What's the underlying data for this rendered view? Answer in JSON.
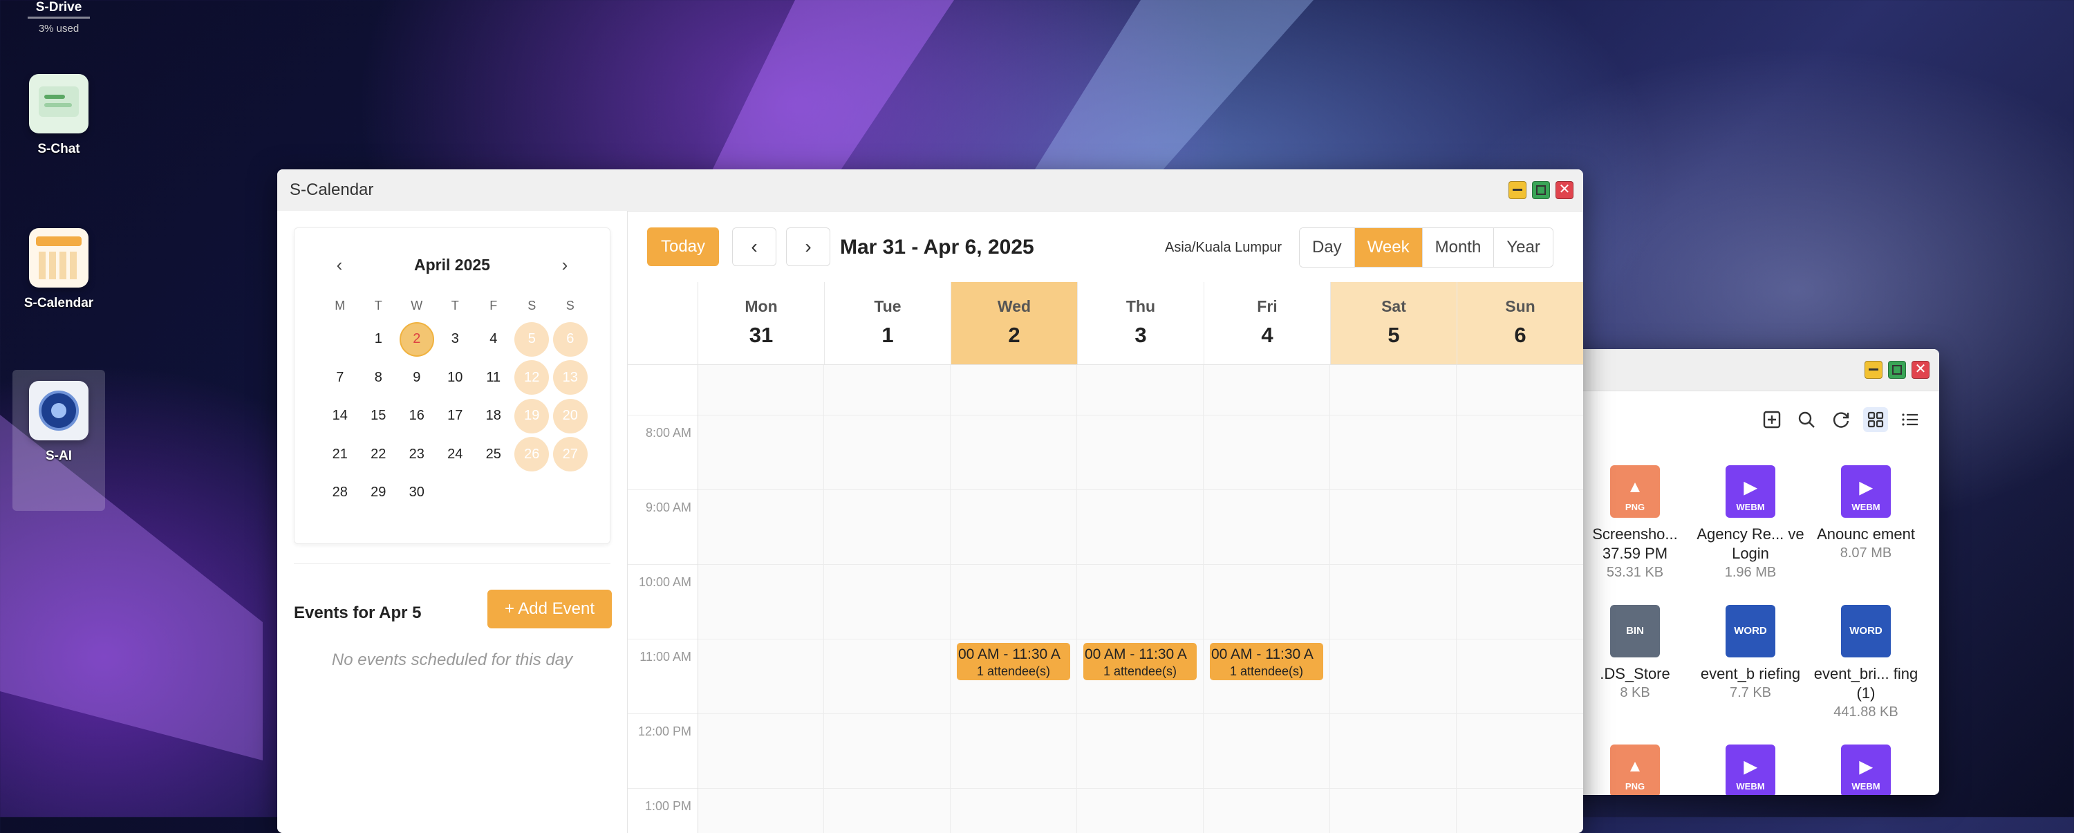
{
  "desktop": {
    "drive_label": "S-Drive",
    "drive_usage": "3% used",
    "icons": [
      {
        "label": "S-Chat",
        "icon": "chat-app-icon"
      },
      {
        "label": "S-Calendar",
        "icon": "calendar-app-icon"
      },
      {
        "label": "S-AI",
        "icon": "ai-app-icon"
      }
    ]
  },
  "calendar_window": {
    "title": "S-Calendar",
    "mini_calendar": {
      "month_label": "April 2025",
      "weekdays": [
        "M",
        "T",
        "W",
        "T",
        "F",
        "S",
        "S"
      ],
      "weeks": [
        [
          "",
          "1",
          "2",
          "3",
          "4",
          "5",
          "6"
        ],
        [
          "7",
          "8",
          "9",
          "10",
          "11",
          "12",
          "13"
        ],
        [
          "14",
          "15",
          "16",
          "17",
          "18",
          "19",
          "20"
        ],
        [
          "21",
          "22",
          "23",
          "24",
          "25",
          "26",
          "27"
        ],
        [
          "28",
          "29",
          "30",
          "",
          "",
          "",
          ""
        ]
      ],
      "today": "2"
    },
    "events_title": "Events for Apr 5",
    "add_event_label": "+ Add Event",
    "no_events_text": "No events scheduled for this day",
    "toolbar": {
      "today_label": "Today",
      "prev_icon": "chevron-left-icon",
      "next_icon": "chevron-right-icon",
      "range_label": "Mar 31 - Apr 6, 2025",
      "timezone": "Asia/Kuala Lumpur",
      "views": [
        "Day",
        "Week",
        "Month",
        "Year"
      ],
      "active_view": "Week"
    },
    "week_days": [
      {
        "name": "Mon",
        "date": "31"
      },
      {
        "name": "Tue",
        "date": "1"
      },
      {
        "name": "Wed",
        "date": "2"
      },
      {
        "name": "Thu",
        "date": "3"
      },
      {
        "name": "Fri",
        "date": "4"
      },
      {
        "name": "Sat",
        "date": "5"
      },
      {
        "name": "Sun",
        "date": "6"
      }
    ],
    "hour_labels": [
      "8:00 AM",
      "9:00 AM",
      "10:00 AM",
      "11:00 AM",
      "12:00 PM",
      "1:00 PM"
    ],
    "events": [
      {
        "day": "Wed",
        "time": "00 AM - 11:30 A",
        "attendees": "1 attendee(s)"
      },
      {
        "day": "Thu",
        "time": "00 AM - 11:30 A",
        "attendees": "1 attendee(s)"
      },
      {
        "day": "Fri",
        "time": "00 AM - 11:30 A",
        "attendees": "1 attendee(s)"
      }
    ]
  },
  "files_window": {
    "toolbar_icons": [
      "new-file-icon",
      "search-icon",
      "refresh-icon",
      "grid-view-icon",
      "list-view-icon"
    ],
    "files": [
      {
        "name": "Screensho... 37.59 PM",
        "size": "53.31 KB",
        "type": "PNG",
        "color": "#f08a62"
      },
      {
        "name": "Agency Re... ve Login",
        "size": "1.96 MB",
        "type": "WEBM",
        "color": "#7a3ff2"
      },
      {
        "name": "Anounc ement",
        "size": "8.07 MB",
        "type": "WEBM",
        "color": "#7a3ff2"
      },
      {
        "name": ".DS_Store",
        "size": "8 KB",
        "type": "BIN",
        "color": "#5f6b7c"
      },
      {
        "name": "event_b riefing",
        "size": "7.7 KB",
        "type": "WORD",
        "color": "#2a56b8"
      },
      {
        "name": "event_bri... fing (1)",
        "size": "441.88 KB",
        "type": "WORD",
        "color": "#2a56b8"
      },
      {
        "name": "",
        "size": "",
        "type": "PNG",
        "color": "#f08a62"
      },
      {
        "name": "",
        "size": "",
        "type": "WEBM",
        "color": "#7a3ff2"
      },
      {
        "name": "",
        "size": "",
        "type": "WEBM",
        "color": "#7a3ff2"
      }
    ]
  }
}
